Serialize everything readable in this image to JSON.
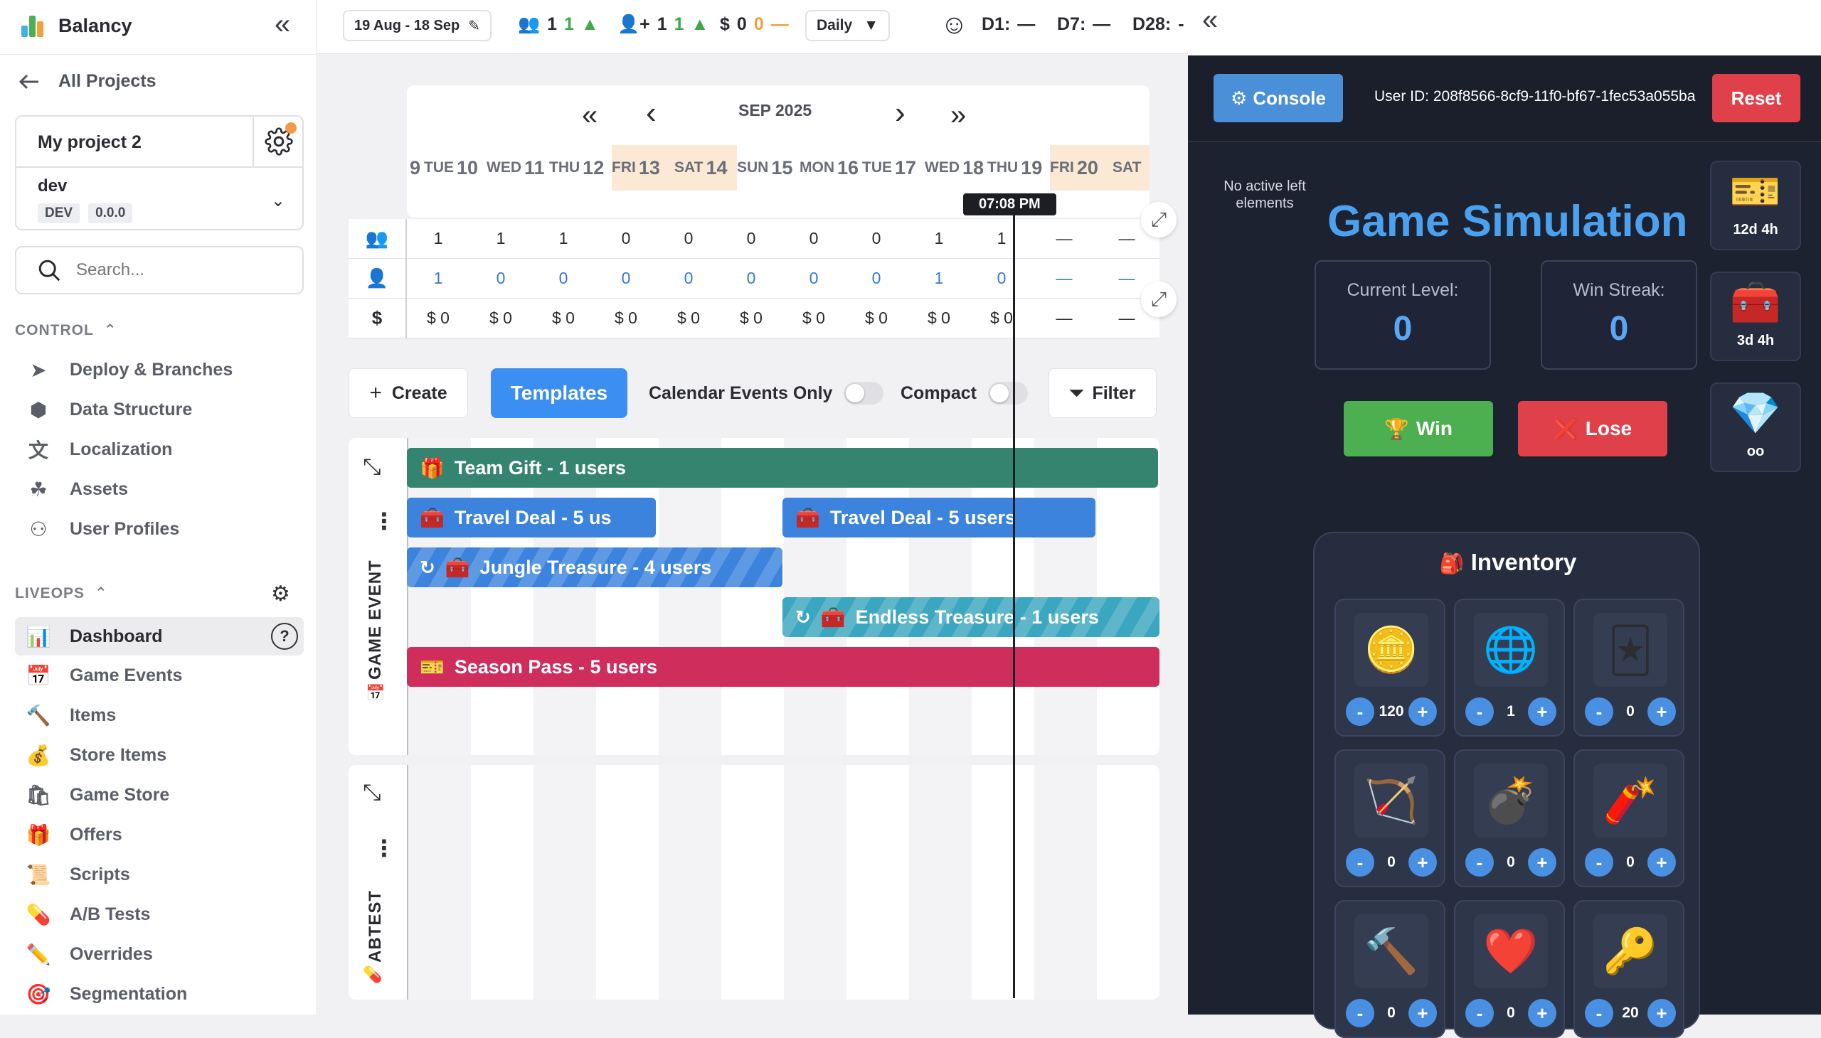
{
  "app": {
    "name": "Balancy",
    "collapse": "«"
  },
  "sidebar": {
    "all_projects": "All Projects",
    "project_name": "My project 2",
    "branch": "dev",
    "env_tag": "DEV",
    "version_tag": "0.0.0",
    "search_placeholder": "Search...",
    "control_label": "CONTROL",
    "control_items": [
      {
        "label": "Deploy & Branches",
        "icon": "send-icon"
      },
      {
        "label": "Data Structure",
        "icon": "cube-icon"
      },
      {
        "label": "Localization",
        "icon": "translate-icon"
      },
      {
        "label": "Assets",
        "icon": "assets-icon"
      },
      {
        "label": "User Profiles",
        "icon": "users-icon"
      }
    ],
    "liveops_label": "LIVEOPS",
    "liveops_items": [
      {
        "label": "Dashboard",
        "icon": "chart-icon",
        "active": true
      },
      {
        "label": "Game Events",
        "icon": "calendar-icon"
      },
      {
        "label": "Items",
        "icon": "hammer-icon"
      },
      {
        "label": "Store Items",
        "icon": "money-bag-icon"
      },
      {
        "label": "Game Store",
        "icon": "shopping-bags-icon"
      },
      {
        "label": "Offers",
        "icon": "gift-icon"
      },
      {
        "label": "Scripts",
        "icon": "scroll-icon"
      },
      {
        "label": "A/B Tests",
        "icon": "pill-icon"
      },
      {
        "label": "Overrides",
        "icon": "pencil-icon"
      },
      {
        "label": "Segmentation",
        "icon": "target-icon"
      }
    ],
    "help": "?"
  },
  "topbar": {
    "date_range": "19 Aug - 18 Sep",
    "users_value": "1",
    "users_delta": "1",
    "new_users_value": "1",
    "new_users_delta": "1",
    "revenue_symbol": "$",
    "revenue_value": "0",
    "revenue_delta": "0",
    "revenue_delta_sign": "—",
    "granularity": "Daily",
    "d1_label": "D1:",
    "d1_value": "—",
    "d7_label": "D7:",
    "d7_value": "—",
    "d28_label": "D28:",
    "d28_value": "-"
  },
  "calendar": {
    "month": "SEP 2025",
    "days": [
      {
        "dow": "",
        "num": "9",
        "weekend": false
      },
      {
        "dow": "TUE",
        "num": "10",
        "weekend": false
      },
      {
        "dow": "WED",
        "num": "11",
        "weekend": false
      },
      {
        "dow": "THU",
        "num": "12",
        "weekend": false
      },
      {
        "dow": "FRI",
        "num": "13",
        "weekend": true
      },
      {
        "dow": "SAT",
        "num": "14",
        "weekend": true
      },
      {
        "dow": "SUN",
        "num": "15",
        "weekend": false
      },
      {
        "dow": "MON",
        "num": "16",
        "weekend": false
      },
      {
        "dow": "TUE",
        "num": "17",
        "weekend": false
      },
      {
        "dow": "WED",
        "num": "18",
        "weekend": false
      },
      {
        "dow": "THU",
        "num": "19",
        "weekend": false
      },
      {
        "dow": "FRI",
        "num": "20",
        "weekend": true
      },
      {
        "dow": "SAT",
        "num": "",
        "weekend": true
      }
    ],
    "current_time": "07:08 PM",
    "rows": {
      "users": [
        "1",
        "1",
        "1",
        "0",
        "0",
        "0",
        "0",
        "0",
        "1",
        "1",
        "—",
        "—"
      ],
      "new_users": [
        "1",
        "0",
        "0",
        "0",
        "0",
        "0",
        "0",
        "0",
        "1",
        "0",
        "—",
        "—"
      ],
      "revenue": [
        "$ 0",
        "$ 0",
        "$ 0",
        "$ 0",
        "$ 0",
        "$ 0",
        "$ 0",
        "$ 0",
        "$ 0",
        "$ 0",
        "—",
        "—"
      ]
    }
  },
  "toolbar": {
    "create": "Create",
    "templates": "Templates",
    "calendar_events_only": "Calendar Events Only",
    "compact": "Compact",
    "filter": "Filter"
  },
  "game_event_section": {
    "label": "GAME EVENT",
    "events": [
      {
        "label": "Team Gift - 1 users",
        "icon": "gift-icon",
        "color": "#35846f"
      },
      {
        "label": "Travel Deal - 5 us",
        "icon": "chest-icon",
        "color": "#3b83dd"
      },
      {
        "label": "Travel Deal - 5 users",
        "icon": "chest-icon",
        "color": "#3b83dd"
      },
      {
        "label": "Jungle Treasure - 4 users",
        "icon": "chest-icon",
        "color": "#3b83dd"
      },
      {
        "label": "Endless Treasure - 1 users",
        "icon": "chest-icon",
        "color": "#3aa6bf"
      },
      {
        "label": "Season Pass - 5 users",
        "icon": "ticket-icon",
        "color": "#cf2d5c"
      }
    ]
  },
  "abtest_section": {
    "label": "ABTEST"
  },
  "simulation": {
    "console": "Console",
    "user_id": "User ID: 208f8566-8cf9-11f0-bf67-1fec53a055ba",
    "reset": "Reset",
    "no_active": "No active left elements",
    "title": "Game Simulation",
    "current_level_label": "Current Level:",
    "current_level": "0",
    "win_streak_label": "Win Streak:",
    "win_streak": "0",
    "win": "Win",
    "lose": "Lose",
    "side_cards": [
      {
        "icon": "ticket-icon",
        "label": "12d 4h"
      },
      {
        "icon": "chest-icon",
        "label": "3d 4h"
      },
      {
        "icon": "treasure-icon",
        "label": "oo"
      }
    ],
    "inventory_title": "Inventory",
    "inventory": [
      {
        "icon": "coins-icon",
        "qty": "120"
      },
      {
        "icon": "ball-icon",
        "qty": "1"
      },
      {
        "icon": "jester-hat-icon",
        "qty": "0"
      },
      {
        "icon": "bow-icon",
        "qty": "0"
      },
      {
        "icon": "cannon-icon",
        "qty": "0"
      },
      {
        "icon": "tnt-icon",
        "qty": "0"
      },
      {
        "icon": "hammer-icon",
        "qty": "0"
      },
      {
        "icon": "heart-chest-icon",
        "qty": "0"
      },
      {
        "icon": "key-icon",
        "qty": "20"
      }
    ]
  }
}
